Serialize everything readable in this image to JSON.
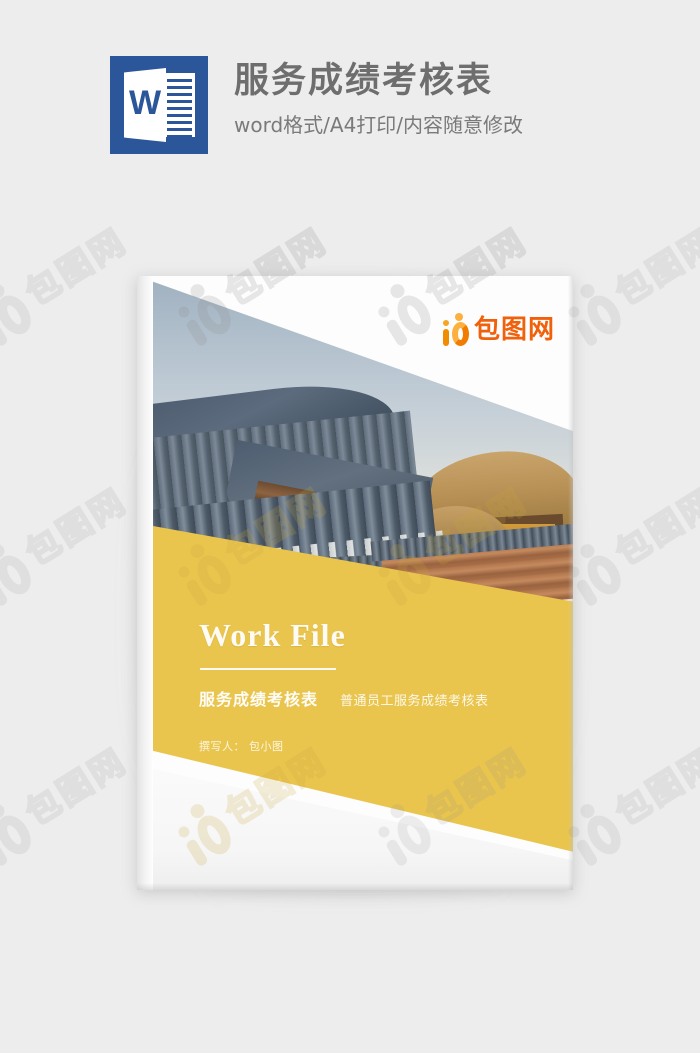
{
  "header": {
    "icon_name": "word-document-icon",
    "icon_letter": "W",
    "icon_color": "#2b579a",
    "title": "服务成绩考核表",
    "subtitle": "word格式/A4打印/内容随意修改"
  },
  "cover": {
    "brand": {
      "logo_icon": "baotu-b-logo-icon",
      "text": "包图网",
      "color": "#f1600a"
    },
    "accent_color": "#eac54e",
    "work_file_label": "Work File",
    "title_cn": "服务成绩考核表",
    "subtitle_cn": "普通员工服务成绩考核表",
    "author_line": "撰写人： 包小图",
    "photo": {
      "name": "traditional-village-rooftops-photo",
      "description": "Traditional Korean hanok village with tiled and thatched roofs against distant mountains at dusk"
    }
  },
  "watermark": {
    "logo_icon": "baotu-b-logo-watermark-icon",
    "text": "包图网"
  }
}
